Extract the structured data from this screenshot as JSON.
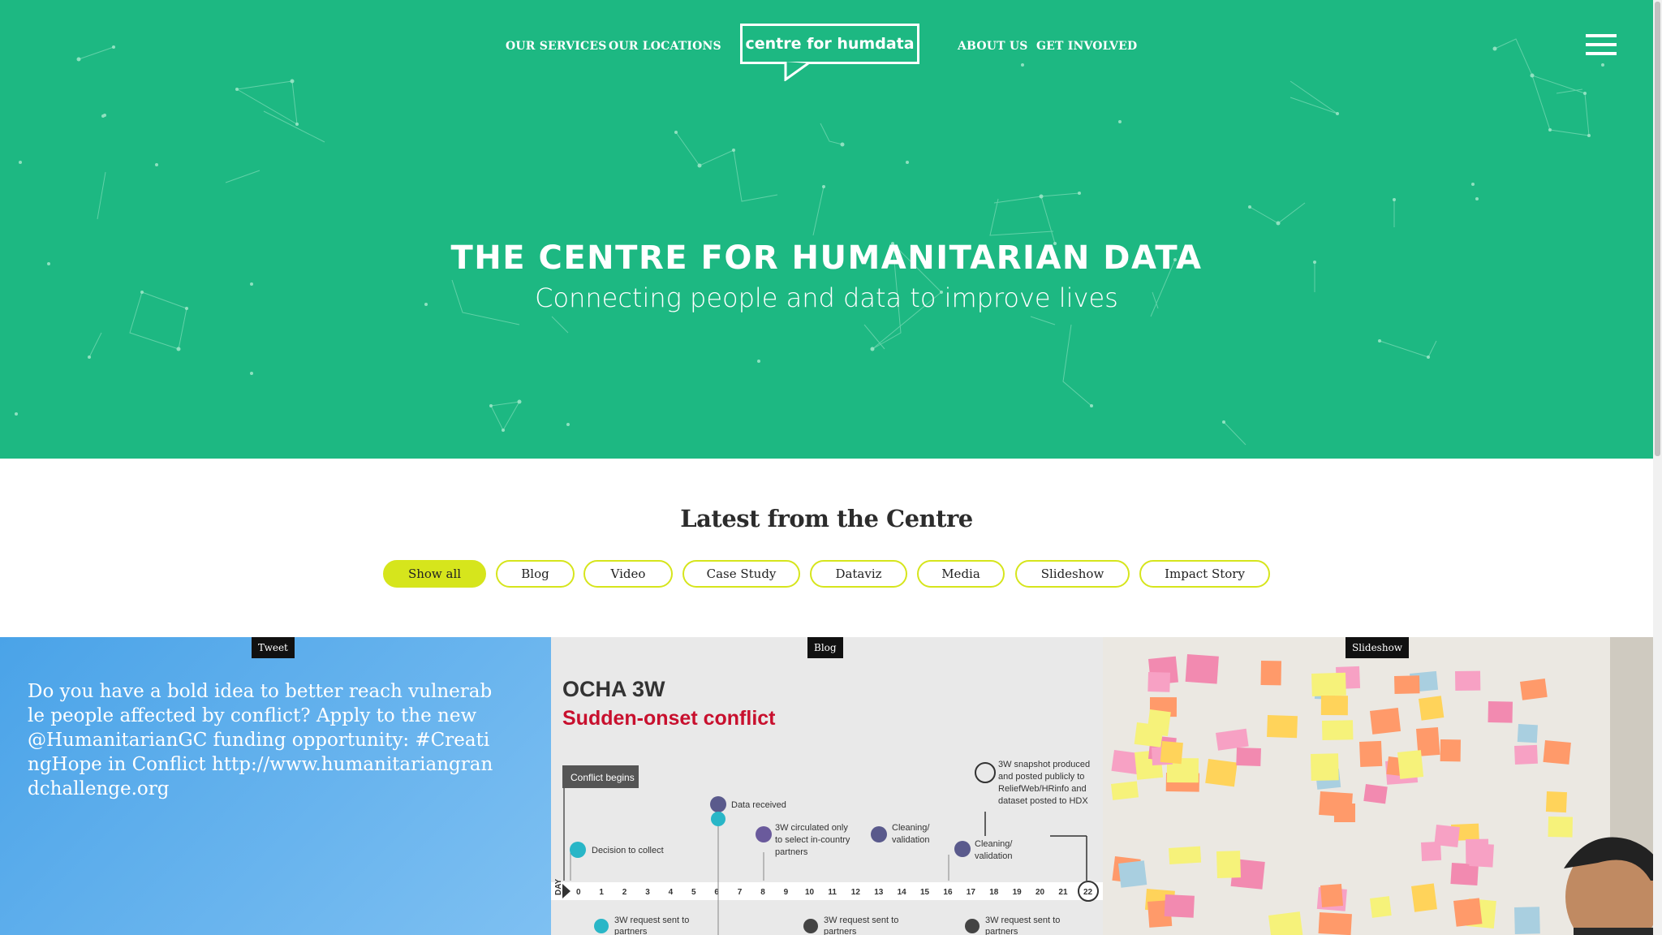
{
  "nav": {
    "left": [
      "OUR SERVICES",
      "OUR LOCATIONS"
    ],
    "right": [
      "ABOUT US",
      "GET INVOLVED"
    ],
    "logo": "centre for humdata"
  },
  "hero": {
    "title": "THE CENTRE FOR HUMANITARIAN DATA",
    "subtitle": "Connecting people and data to improve lives",
    "color": "#1db882"
  },
  "latest": {
    "title": "Latest from the Centre",
    "filters": [
      "Show all",
      "Blog",
      "Video",
      "Case Study",
      "Dataviz",
      "Media",
      "Slideshow",
      "Impact Story"
    ],
    "active_filter": "Show all",
    "accent": "#d6e51c"
  },
  "cards": [
    {
      "tag": "Tweet",
      "text": "Do you have a bold idea to better reach vulnerable people affected by conflict? Apply to the new @HumanitarianGC funding opportunity: #CreatingHope in Conflict http://www.humanitariangrandchallenge.org"
    },
    {
      "tag": "Blog",
      "image": {
        "title": "OCHA 3W",
        "subtitle": "Sudden-onset conflict",
        "conflict_label": "Conflict begins",
        "day_label": "DAY",
        "events": [
          "Decision to collect",
          "Data received",
          "3W circulated only to select in-country partners",
          "Cleaning/ validation",
          "Cleaning/ validation",
          "3W snapshot produced and posted publicly to ReliefWeb/HRinfo and dataset posted to HDX"
        ],
        "days": [
          "0",
          "1",
          "2",
          "3",
          "4",
          "5",
          "6",
          "7",
          "8",
          "9",
          "10",
          "11",
          "12",
          "13",
          "14",
          "15",
          "16",
          "17",
          "18",
          "19",
          "20",
          "21",
          "22"
        ],
        "requests": [
          "3W request sent to partners",
          "3W request sent to partners",
          "3W request sent to partners"
        ]
      }
    },
    {
      "tag": "Slideshow"
    }
  ]
}
